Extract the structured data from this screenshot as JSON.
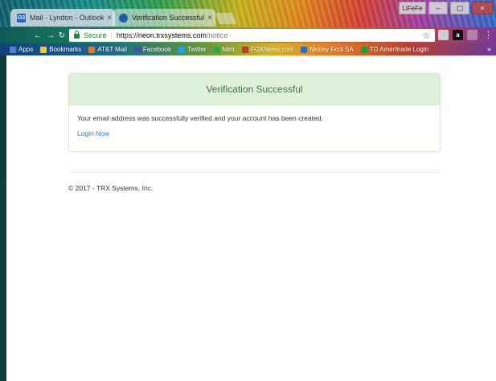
{
  "browser": {
    "tabs": [
      {
        "label": "Mail - Lyndon - Outlook",
        "favicon": "O3",
        "active": false
      },
      {
        "label": "Verification Successful",
        "favicon": "",
        "active": true
      }
    ],
    "window_buttons": {
      "user": "LiFeFe"
    },
    "address": {
      "secure_label": "Secure",
      "url_scheme": "https://",
      "url_host": "neon.trxsystems.com",
      "url_path": "/notice"
    },
    "extensions": [
      "a"
    ],
    "bookmarks": [
      {
        "label": "Apps",
        "color": "#4a7fd4"
      },
      {
        "label": "Bookmarks",
        "color": "#e8c542"
      },
      {
        "label": "AT&T Mail",
        "color": "#e07a2a"
      },
      {
        "label": "Facebook",
        "color": "#3b5998"
      },
      {
        "label": "Twitter",
        "color": "#1da1f2"
      },
      {
        "label": "Mint",
        "color": "#2ea44f"
      },
      {
        "label": "FOXNews.com",
        "color": "#c0392b"
      },
      {
        "label": "Motley Fool SA",
        "color": "#2a6fc7"
      },
      {
        "label": "TD Ameritrade Login",
        "color": "#2c9a3a"
      }
    ],
    "bookmarks_more": "»"
  },
  "page": {
    "panel_title": "Verification Successful",
    "message": "Your email address was successfully verified and your account has been created.",
    "login_link": "Login Now",
    "footer": "© 2017 - TRX Systems, Inc."
  },
  "colors": {
    "panel_header_bg": "#dff0d8",
    "panel_header_text": "#3c763d",
    "link": "#337ab7"
  }
}
